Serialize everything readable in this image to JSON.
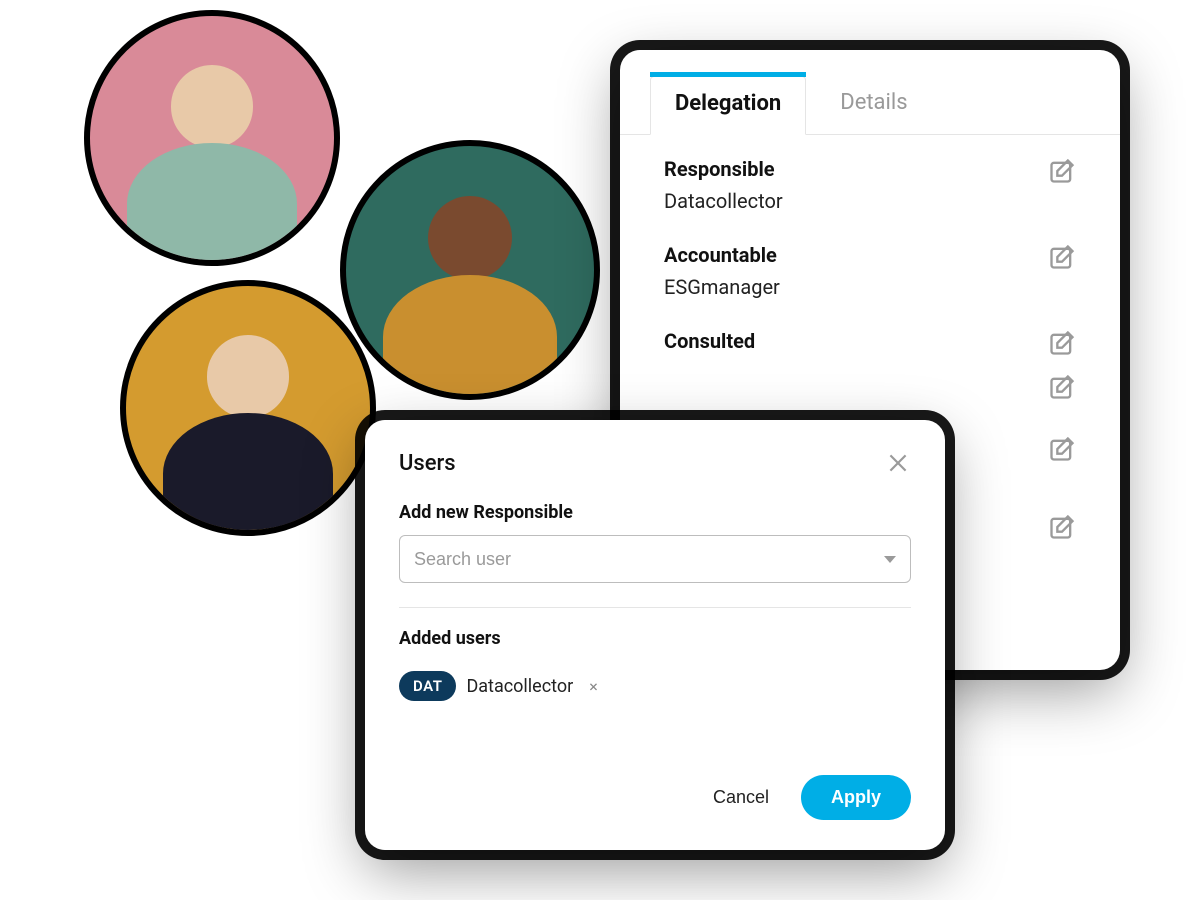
{
  "avatars": [
    {
      "name": "avatar-1"
    },
    {
      "name": "avatar-2"
    },
    {
      "name": "avatar-3"
    }
  ],
  "delegation": {
    "tabs": {
      "active": "Delegation",
      "inactive": "Details"
    },
    "roles": [
      {
        "label": "Responsible",
        "value": "Datacollector"
      },
      {
        "label": "Accountable",
        "value": "ESGmanager"
      },
      {
        "label": "Consulted",
        "value": ""
      }
    ]
  },
  "users_modal": {
    "title": "Users",
    "field_label": "Add new Responsible",
    "search_placeholder": "Search user",
    "added_label": "Added users",
    "chip_badge": "DAT",
    "chip_label": "Datacollector",
    "cancel": "Cancel",
    "apply": "Apply"
  }
}
